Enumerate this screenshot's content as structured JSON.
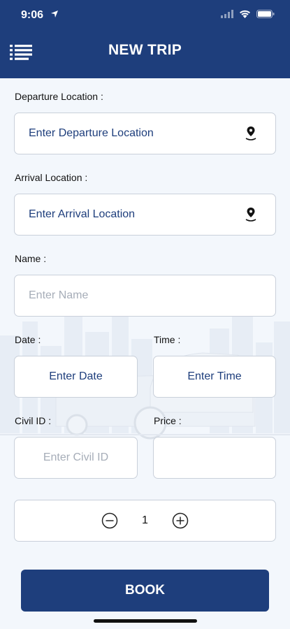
{
  "status_bar": {
    "time": "9:06"
  },
  "header": {
    "title": "NEW TRIP"
  },
  "form": {
    "departure": {
      "label": "Departure Location :",
      "value": "Enter Departure Location"
    },
    "arrival": {
      "label": "Arrival Location :",
      "value": "Enter Arrival Location"
    },
    "name": {
      "label": "Name :",
      "placeholder": "Enter Name"
    },
    "date": {
      "label": "Date :",
      "value": "Enter Date"
    },
    "time": {
      "label": "Time :",
      "value": "Enter Time"
    },
    "civil_id": {
      "label": "Civil ID :",
      "placeholder": "Enter Civil ID"
    },
    "price": {
      "label": "Price :",
      "value": ""
    },
    "quantity": {
      "value": "1"
    }
  },
  "actions": {
    "book_label": "BOOK"
  },
  "colors": {
    "primary": "#1e3e7c",
    "background": "#f3f7fc",
    "border": "#c9d0da",
    "placeholder": "#a6adb8"
  }
}
